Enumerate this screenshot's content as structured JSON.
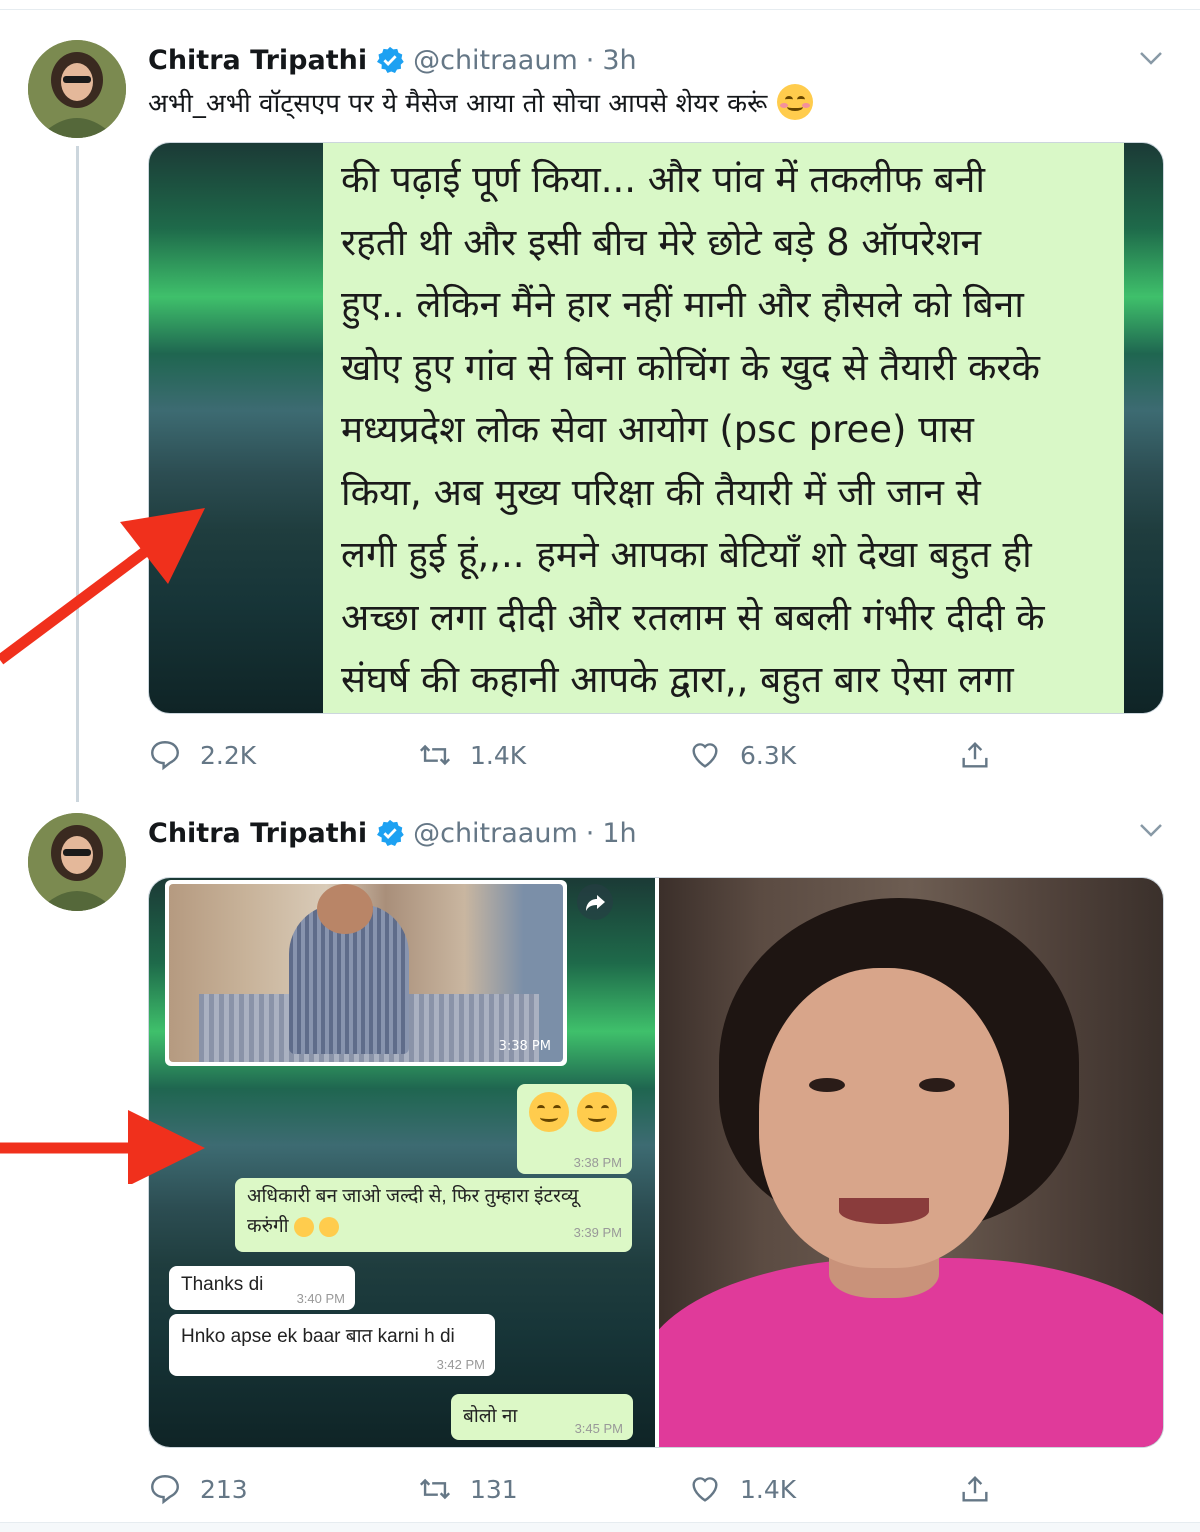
{
  "tweets": [
    {
      "name": "Chitra Tripathi",
      "handle": "@chitraaum",
      "separator": "·",
      "time": "3h",
      "text": "अभी_अभी वॉट्सएप पर ये मैसेज आया तो सोचा आपसे शेयर करूं",
      "emoji": "smiling-face-with-smiling-eyes-icon",
      "image_text_lines": [
        "की पढ़ाई पूर्ण किया... और पांव में तकलीफ बनी",
        "रहती थी और इसी बीच मेरे छोटे बड़े 8 ऑपरेशन",
        "हुए.. लेकिन मैंने हार नहीं मानी और हौसले को बिना",
        "खोए हुए गांव से बिना कोचिंग के खुद से तैयारी करके",
        "मध्यप्रदेश लोक सेवा आयोग (psc pree) पास",
        "किया, अब मुख्य परिक्षा की तैयारी में जी जान से",
        "लगी हुई हूं,,.. हमने आपका बेटियाँ शो देखा बहुत ही",
        "अच्छा लगा दीदी और रतलाम से बबली गंभीर दीदी के",
        "संघर्ष की कहानी आपके द्वारा,, बहुत बार ऐसा लगा"
      ],
      "stats": {
        "replies": "2.2K",
        "retweets": "1.4K",
        "likes": "6.3K"
      }
    },
    {
      "name": "Chitra Tripathi",
      "handle": "@chitraaum",
      "separator": "·",
      "time": "1h",
      "chat": {
        "photo_time": "3:38 PM",
        "messages": [
          {
            "dir": "out",
            "text": "",
            "time": "3:38 PM"
          },
          {
            "dir": "out",
            "text": "अधिकारी बन जाओ जल्दी से, फिर तुम्हारा इंटरव्यू",
            "text2": "करुंगी",
            "time": "3:39 PM"
          },
          {
            "dir": "in",
            "text": "Thanks di",
            "time": "3:40 PM"
          },
          {
            "dir": "in",
            "text": "Hnko apse ek baar बात karni h di",
            "time": "3:42 PM"
          },
          {
            "dir": "out",
            "text": "बोलो ना",
            "time": "3:45 PM"
          }
        ]
      },
      "stats": {
        "replies": "213",
        "retweets": "131",
        "likes": "1.4K"
      }
    }
  ],
  "icons": {
    "verified": "verified-badge-icon",
    "caret": "chevron-down-icon",
    "reply": "reply-icon",
    "retweet": "retweet-icon",
    "like": "heart-icon",
    "share": "share-icon",
    "arrow": "red-arrow-annotation"
  },
  "colors": {
    "verified_blue": "#1da1f2",
    "muted": "#657786",
    "annotation_red": "#f0301c",
    "whatsapp_green": "#dcf8c6"
  }
}
